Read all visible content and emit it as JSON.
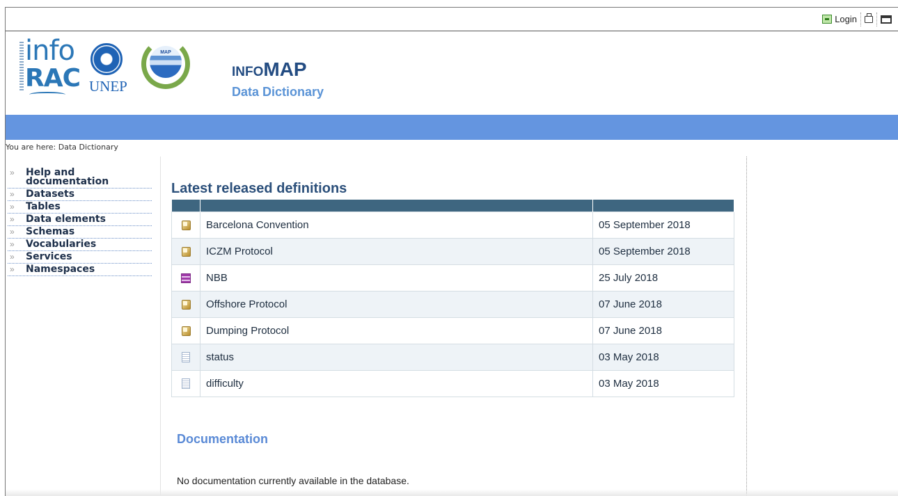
{
  "toolbar": {
    "login_label": "Login"
  },
  "header": {
    "logo_info_line1": "info",
    "logo_info_line2": "RAC",
    "logo_unep": "UNEP",
    "logo_map": "MAP",
    "title_prefix": "INFO",
    "title_main": "MAP",
    "subtitle": "Data Dictionary"
  },
  "breadcrumb": "You are here: Data Dictionary",
  "nav": {
    "items": [
      {
        "label": "Help and documentation"
      },
      {
        "label": "Datasets"
      },
      {
        "label": "Tables"
      },
      {
        "label": "Data elements"
      },
      {
        "label": "Schemas"
      },
      {
        "label": "Vocabularies"
      },
      {
        "label": "Services"
      },
      {
        "label": "Namespaces"
      }
    ]
  },
  "main": {
    "heading": "Latest released definitions",
    "definitions": [
      {
        "icon": "dataset-icon",
        "name": "Barcelona Convention",
        "date": "05 September 2018"
      },
      {
        "icon": "dataset-icon",
        "name": "ICZM Protocol",
        "date": "05 September 2018"
      },
      {
        "icon": "schema-icon",
        "name": "NBB",
        "date": "25 July 2018"
      },
      {
        "icon": "dataset-icon",
        "name": "Offshore Protocol",
        "date": "07 June 2018"
      },
      {
        "icon": "dataset-icon",
        "name": "Dumping Protocol",
        "date": "07 June 2018"
      },
      {
        "icon": "document-icon",
        "name": "status",
        "date": "03 May 2018"
      },
      {
        "icon": "document-icon",
        "name": "difficulty",
        "date": "03 May 2018"
      }
    ],
    "doc_heading": "Documentation",
    "doc_text": "No documentation currently available in the database."
  },
  "colors": {
    "band": "#6495e0",
    "table_header": "#3e6680",
    "heading": "#2b4f7a",
    "doc_heading": "#5a8ad6"
  }
}
